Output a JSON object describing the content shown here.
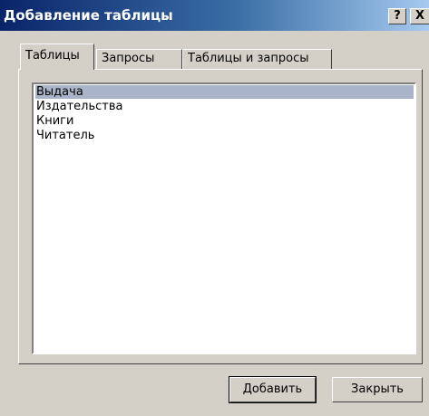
{
  "window": {
    "title": "Добавление таблицы",
    "help_label": "?",
    "close_label": "X"
  },
  "tabs": [
    {
      "label": "Таблицы",
      "active": true
    },
    {
      "label": "Запросы",
      "active": false
    },
    {
      "label": "Таблицы и запросы",
      "active": false
    }
  ],
  "list": {
    "items": [
      {
        "label": "Выдача",
        "selected": true
      },
      {
        "label": "Издательства",
        "selected": false
      },
      {
        "label": "Книги",
        "selected": false
      },
      {
        "label": "Читатель",
        "selected": false
      }
    ]
  },
  "buttons": {
    "add_label": "Добавить",
    "close_label": "Закрыть"
  },
  "colors": {
    "title_bar_start": "#0a246a",
    "title_bar_end": "#a6caf0",
    "selection": "#a9b4c8",
    "face": "#d4d0c8"
  }
}
